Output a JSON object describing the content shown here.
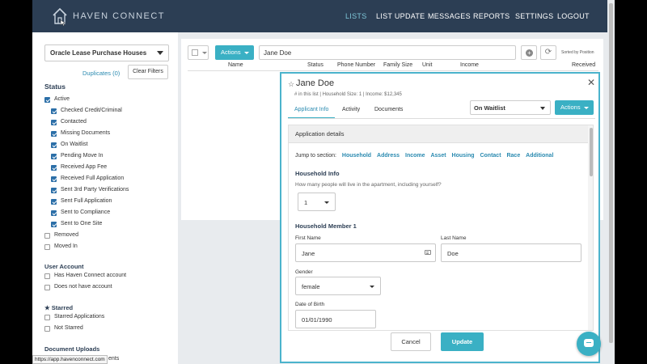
{
  "nav": {
    "brand": "HAVEN CONNECT",
    "links": [
      "LISTS",
      "LIST UPDATE",
      "MESSAGES",
      "REPORTS",
      "SETTINGS",
      "LOGOUT"
    ],
    "accent": "#7ec6d8"
  },
  "sidebar": {
    "list_select": "Oracle Lease Purchase Houses",
    "duplicates": "Duplicates (0)",
    "clear_filters": "Clear Filters",
    "status_title": "Status",
    "status_items": [
      {
        "label": "Active",
        "checked": true
      },
      {
        "label": "Checked Credit/Criminal",
        "checked": true
      },
      {
        "label": "Contacted",
        "checked": true
      },
      {
        "label": "Missing Documents",
        "checked": true
      },
      {
        "label": "On Waitlist",
        "checked": true
      },
      {
        "label": "Pending Move In",
        "checked": true
      },
      {
        "label": "Received App Fee",
        "checked": true
      },
      {
        "label": "Received Full Application",
        "checked": true
      },
      {
        "label": "Sent 3rd Party Verifications",
        "checked": true
      },
      {
        "label": "Sent Full Application",
        "checked": true
      },
      {
        "label": "Sent to Compliance",
        "checked": true
      },
      {
        "label": "Sent to One Site",
        "checked": true
      },
      {
        "label": "Removed",
        "checked": false
      },
      {
        "label": "Moved In",
        "checked": false
      }
    ],
    "user_account_title": "User Account",
    "user_account_items": [
      {
        "label": "Has Haven Connect account",
        "checked": false
      },
      {
        "label": "Does not have account",
        "checked": false
      }
    ],
    "starred_title": "★ Starred",
    "starred_items": [
      {
        "label": "Starred Applications",
        "checked": false
      },
      {
        "label": "Not Starred",
        "checked": false
      }
    ],
    "doc_uploads_title": "Document Uploads",
    "status_url": "https://app.havenconnect.com",
    "doc_uploads_partial": "ents"
  },
  "main": {
    "actions": "Actions",
    "search_value": "Jane Doe",
    "sorted_by": "Sorted by Position",
    "columns": [
      "Name",
      "Status",
      "Phone Number",
      "Family Size",
      "Unit",
      "Income",
      "Received"
    ]
  },
  "modal": {
    "star": "☆",
    "name": "Jane Doe",
    "subtitle": "# in this list | Household Size: 1 | Income: $12,345",
    "close": "✕",
    "tabs": [
      "Applicant Info",
      "Activity",
      "Documents"
    ],
    "status_select": "On Waitlist",
    "actions": "Actions",
    "form": {
      "header": "Application details",
      "jump_label": "Jump to section:",
      "jump_links": [
        "Household",
        "Address",
        "Income",
        "Asset",
        "Housing",
        "Contact",
        "Race",
        "Additional"
      ],
      "household_info": "Household Info",
      "household_question": "How many people will live in the apartment, including yourself?",
      "household_count": "1",
      "member_heading": "Household Member 1",
      "first_name_label": "First Name",
      "first_name": "Jane",
      "last_name_label": "Last Name",
      "last_name": "Doe",
      "gender_label": "Gender",
      "gender": "female",
      "dob_label": "Date of Birth",
      "dob": "01/01/1990"
    },
    "cancel": "Cancel",
    "update": "Update"
  }
}
